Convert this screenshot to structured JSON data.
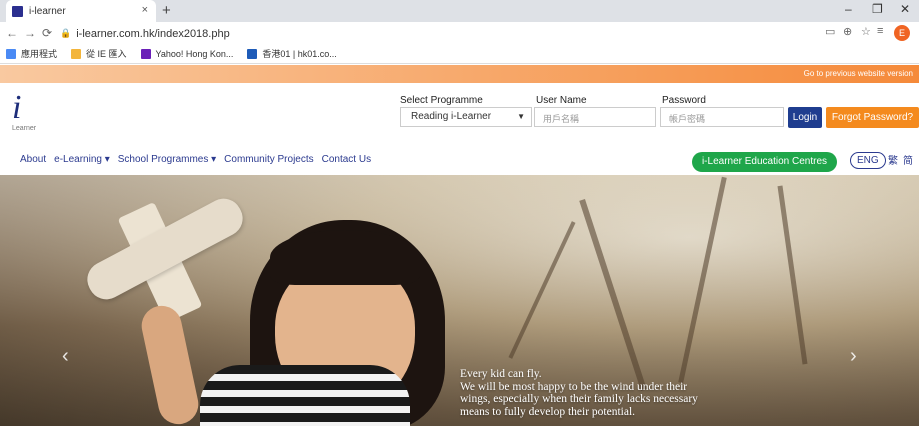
{
  "browser": {
    "tab_title": "i-learner",
    "tab_close": "×",
    "new_tab": "+",
    "url": "i-learner.com.hk/index2018.php",
    "profile_initial": "E",
    "bookmarks": [
      {
        "label": "應用程式",
        "color": "#4a8af4"
      },
      {
        "label": "從 IE 匯入",
        "color": "#f3b53b"
      },
      {
        "label": "Yahoo! Hong Kon...",
        "color": "#6a1fb8"
      },
      {
        "label": "香港01 | hk01.co...",
        "color": "#1e5bb8"
      }
    ]
  },
  "site": {
    "prev_version_link": "Go to previous website version",
    "logo_text": "Learner",
    "login": {
      "programme_label": "Select Programme",
      "programme_value": "Reading i-Learner",
      "username_label": "User Name",
      "username_placeholder": "用戶名稱",
      "password_label": "Password",
      "password_placeholder": "帳戶密碼",
      "login_button": "Login",
      "forgot_button": "Forgot Password?"
    },
    "nav": [
      "About",
      "e-Learning ▾",
      "School Programmes ▾",
      "Community Projects",
      "Contact Us"
    ],
    "centres_button": "i-Learner Education Centres",
    "lang": {
      "eng": "ENG",
      "trad": "繁",
      "simp": "简"
    },
    "hero": {
      "caption_lines": [
        "Every kid can fly.",
        "We will be most happy to be the wind under their",
        "wings, especially when their family lacks necessary",
        "means to fully develop their potential."
      ],
      "prev_arrow": "‹",
      "next_arrow": "›"
    }
  },
  "colors": {
    "brand_blue": "#1f3d8f",
    "accent_orange": "#f48a1e",
    "centres_green": "#1fa64a"
  }
}
